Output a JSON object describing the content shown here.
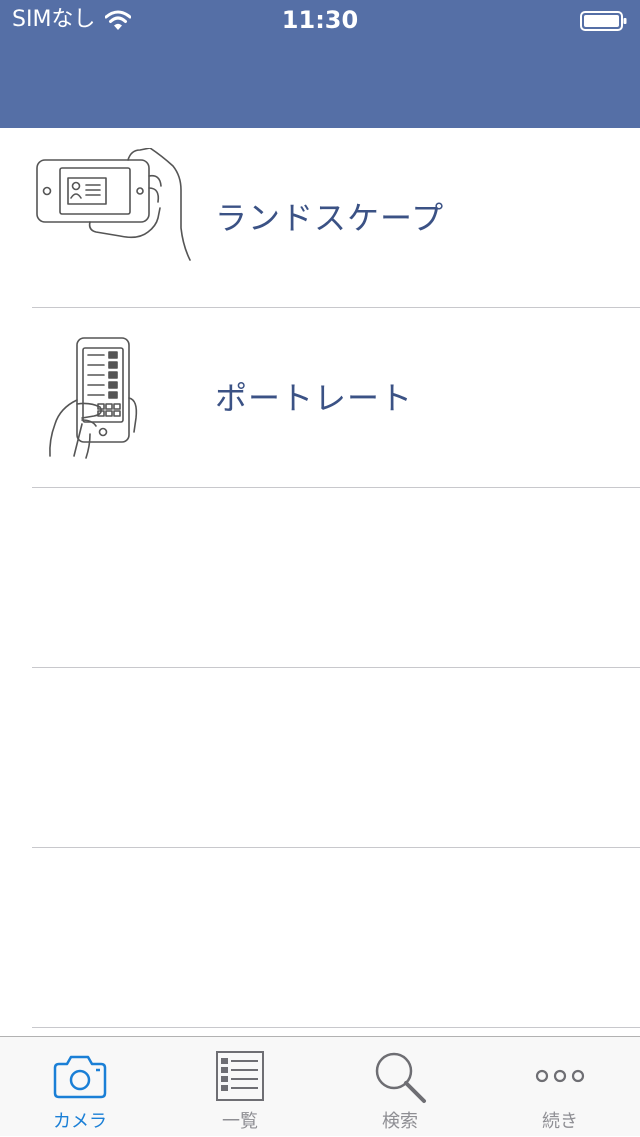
{
  "status_bar": {
    "carrier": "SIMなし",
    "time": "11:30"
  },
  "list": {
    "items": [
      {
        "label": "ランドスケープ",
        "icon": "landscape-phone-icon"
      },
      {
        "label": "ポートレート",
        "icon": "portrait-phone-icon"
      },
      {
        "label": "",
        "icon": ""
      },
      {
        "label": "",
        "icon": ""
      },
      {
        "label": "",
        "icon": ""
      }
    ]
  },
  "tab_bar": {
    "tabs": [
      {
        "label": "カメラ",
        "icon": "camera-icon",
        "active": true
      },
      {
        "label": "一覧",
        "icon": "list-icon",
        "active": false
      },
      {
        "label": "検索",
        "icon": "search-icon",
        "active": false
      },
      {
        "label": "続き",
        "icon": "more-icon",
        "active": false
      }
    ]
  },
  "colors": {
    "header": "#556fa6",
    "accent": "#1a7fd6",
    "row_label": "#3b5285",
    "tab_inactive": "#8e8e93"
  }
}
